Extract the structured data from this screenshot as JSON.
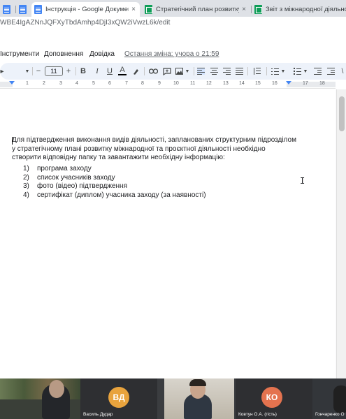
{
  "browser": {
    "tabs": [
      {
        "title": "",
        "icon": "docs-icon"
      },
      {
        "title": "",
        "icon": "docs-icon"
      },
      {
        "title": "Інструкція - Google Документи",
        "icon": "docs-icon",
        "active": true
      },
      {
        "title": "Стратегічний план розвитку міжн",
        "icon": "sheets-icon"
      },
      {
        "title": "Звіт з міжнародної діяльності",
        "icon": "sheets-icon"
      }
    ],
    "close_glyph": "×",
    "url": "WBE4IgAZNnJQFXyTbdAmhp4DjI3xQW2iVwzL6k/edit"
  },
  "menu": {
    "items": [
      "Інструменти",
      "Доповнення",
      "Довідка"
    ],
    "last_edit": "Остання зміна: учора о 21:59"
  },
  "toolbar": {
    "font_size": "11",
    "minus": "−",
    "plus": "+",
    "bold": "B",
    "italic": "I",
    "underline": "U",
    "text_color": "A"
  },
  "ruler": {
    "numbers": [
      "1",
      "2",
      "3",
      "4",
      "5",
      "6",
      "7",
      "8",
      "9",
      "10",
      "11",
      "12",
      "13",
      "14",
      "15",
      "16",
      "17",
      "18"
    ]
  },
  "document": {
    "paragraph": [
      "Для підтвердження виконання видів діяльності, запланованих структурним підрозділом",
      "у стратегічному плані розвитку міжнародної та проєктної діяльності необхідно",
      "створити відповідну папку та завантажити необхідну  інформацію:"
    ],
    "list": [
      {
        "num": "1)",
        "text": "програма заходу"
      },
      {
        "num": "2)",
        "text": "список учасників заходу"
      },
      {
        "num": "3)",
        "text": "фото (відео) підтвердження"
      },
      {
        "num": "4)",
        "text": "сертифікат (диплом) учасника заходу (за наявності)"
      }
    ]
  },
  "meeting": {
    "participants": [
      {
        "name": "",
        "type": "video"
      },
      {
        "name": "Василь Дудар",
        "initials": "ВД",
        "color": "#e8a33d",
        "type": "avatar"
      },
      {
        "name": "Ковтун О.А. (гість)",
        "type": "video"
      },
      {
        "name": "",
        "initials": "КО",
        "color": "#e4734f",
        "type": "avatar"
      },
      {
        "name": "Гончаренко О",
        "type": "video"
      }
    ]
  }
}
